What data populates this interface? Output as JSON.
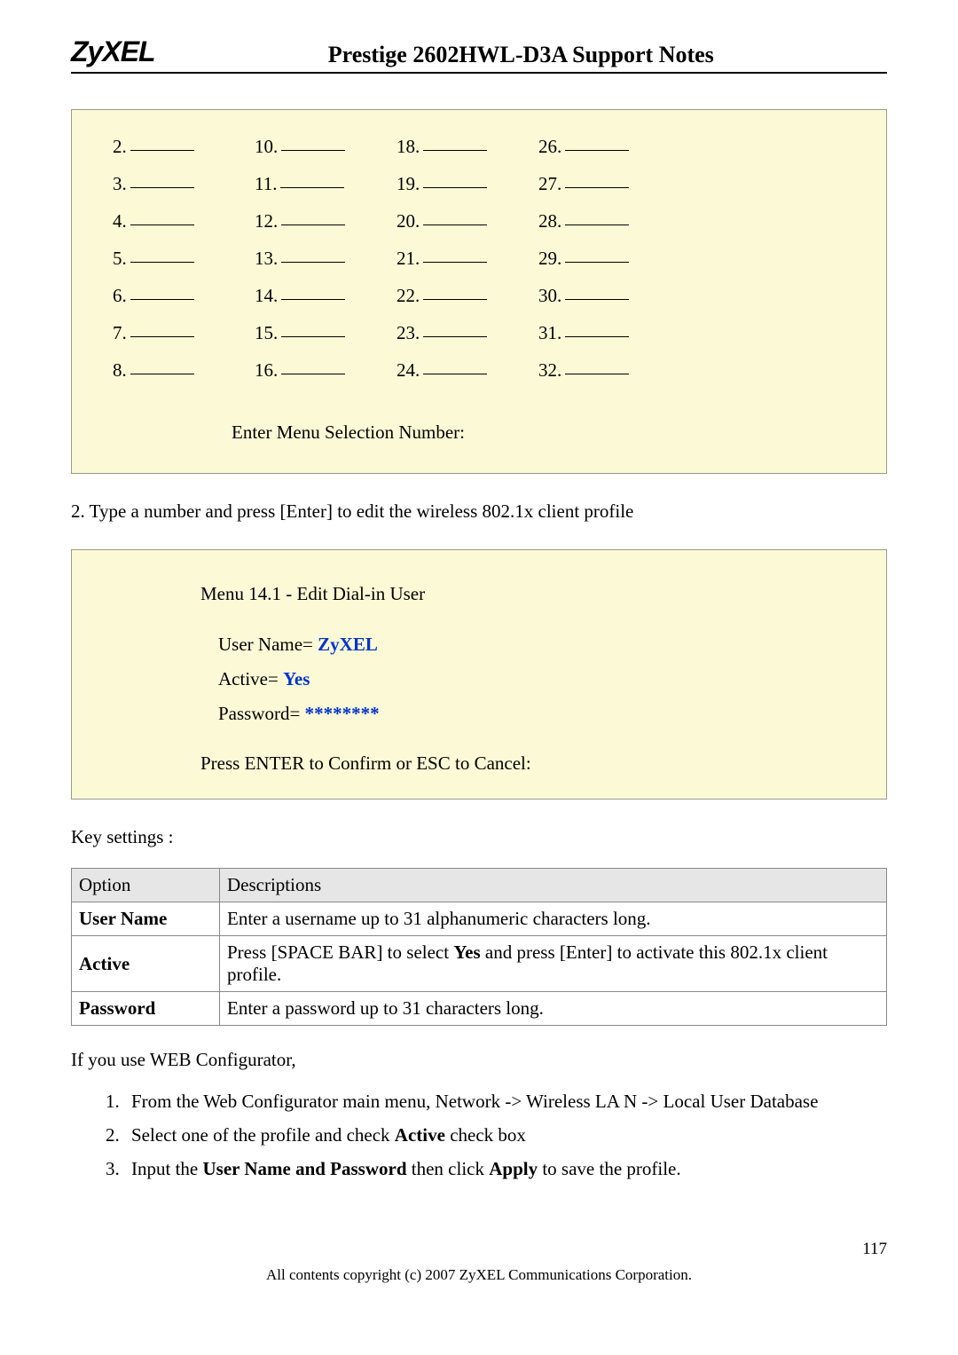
{
  "header": {
    "logo_text": "ZyXEL",
    "doc_title": "Prestige 2602HWL-D3A Support Notes"
  },
  "menu": {
    "columns": [
      [
        "2.",
        "3.",
        "4.",
        "5.",
        "6.",
        "7.",
        "8."
      ],
      [
        "10.",
        "11.",
        "12.",
        "13.",
        "14.",
        "15.",
        "16."
      ],
      [
        "18.",
        "19.",
        "20.",
        "21.",
        "22.",
        "23.",
        "24."
      ],
      [
        "26.",
        "27.",
        "28.",
        "29.",
        "30.",
        "31.",
        "32."
      ]
    ],
    "prompt": "Enter Menu Selection Number:"
  },
  "step2_text": "2. Type a number and press [Enter] to edit the wireless 802.1x client profile",
  "edit": {
    "title": "Menu 14.1 - Edit Dial-in User",
    "user_label": "User Name= ",
    "user_value": "ZyXEL",
    "active_label": "Active= ",
    "active_value": "Yes",
    "password_label": "Password= ",
    "password_value": "********",
    "confirm": "Press ENTER to Confirm or ESC to Cancel:"
  },
  "key_settings_label": "Key settings :",
  "table": {
    "headers": {
      "option": "Option",
      "desc": "Descriptions"
    },
    "rows": [
      {
        "option": "User Name",
        "desc_parts": [
          "Enter a username up to 31 alphanumeric characters long."
        ]
      },
      {
        "option": "Active",
        "desc_parts": [
          "Press [SPACE BAR] to select ",
          {
            "bold": "Yes"
          },
          " and press [Enter] to activate this 802.1x client profile."
        ]
      },
      {
        "option": "Password",
        "desc_parts": [
          "Enter a password up to 31 characters long."
        ]
      }
    ]
  },
  "web_config_intro": "If you use WEB Configurator,",
  "web_steps": [
    [
      "From the Web Configurator main menu, Network -> Wireless LA N -> Local User Database"
    ],
    [
      "Select one of the profile and check ",
      {
        "bold": "Active"
      },
      " check box"
    ],
    [
      "Input the ",
      {
        "bold": "User Name and Password"
      },
      " then click ",
      {
        "bold": "Apply"
      },
      " to save the profile."
    ]
  ],
  "footer": {
    "page_number": "117",
    "copyright": "All contents copyright (c) 2007 ZyXEL Communications Corporation."
  }
}
